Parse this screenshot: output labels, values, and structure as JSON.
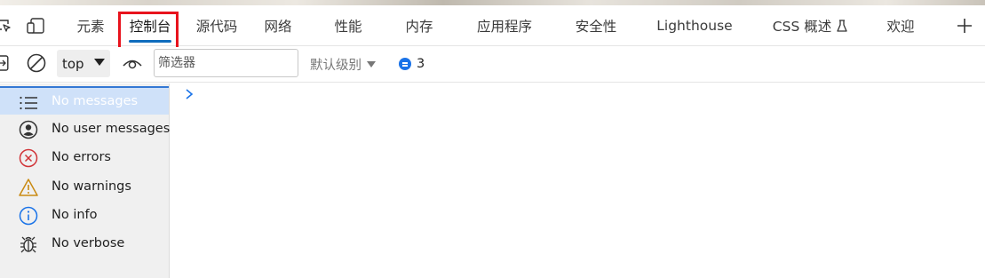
{
  "tabs": [
    {
      "id": "elements",
      "label": "元素"
    },
    {
      "id": "console",
      "label": "控制台",
      "active": true
    },
    {
      "id": "sources",
      "label": "源代码"
    },
    {
      "id": "network",
      "label": "网络"
    },
    {
      "id": "performance",
      "label": "性能"
    },
    {
      "id": "memory",
      "label": "内存"
    },
    {
      "id": "application",
      "label": "应用程序"
    },
    {
      "id": "security",
      "label": "安全性"
    },
    {
      "id": "lighthouse",
      "label": "Lighthouse"
    },
    {
      "id": "css-overview",
      "label": "CSS 概述",
      "icon": "flask-icon"
    },
    {
      "id": "welcome",
      "label": "欢迎"
    }
  ],
  "tabbar_icons": [
    "inspect-element-icon",
    "device-emulation-icon",
    "add-tab-icon"
  ],
  "toolbar": {
    "context": "top",
    "filter_placeholder": "筛选器",
    "filter_value": "",
    "levels_label": "默认级别",
    "issues_count": "3",
    "icons": [
      "sidebar-toggle-icon",
      "clear-console-icon",
      "live-expression-eye-icon",
      "issues-message-icon"
    ]
  },
  "sidebar": {
    "items": [
      {
        "label": "No messages",
        "icon": "list-icon",
        "selected": true
      },
      {
        "label": "No user messages",
        "icon": "user-icon"
      },
      {
        "label": "No errors",
        "icon": "error-icon"
      },
      {
        "label": "No warnings",
        "icon": "warning-icon"
      },
      {
        "label": "No info",
        "icon": "info-icon"
      },
      {
        "label": "No verbose",
        "icon": "bug-icon"
      }
    ]
  },
  "colors": {
    "accent": "#0f6cbd",
    "highlight_box": "#e8131d",
    "selected_row": "#cfe1f9",
    "error": "#d13438",
    "warning": "#c98a12",
    "info": "#1a73e8"
  }
}
